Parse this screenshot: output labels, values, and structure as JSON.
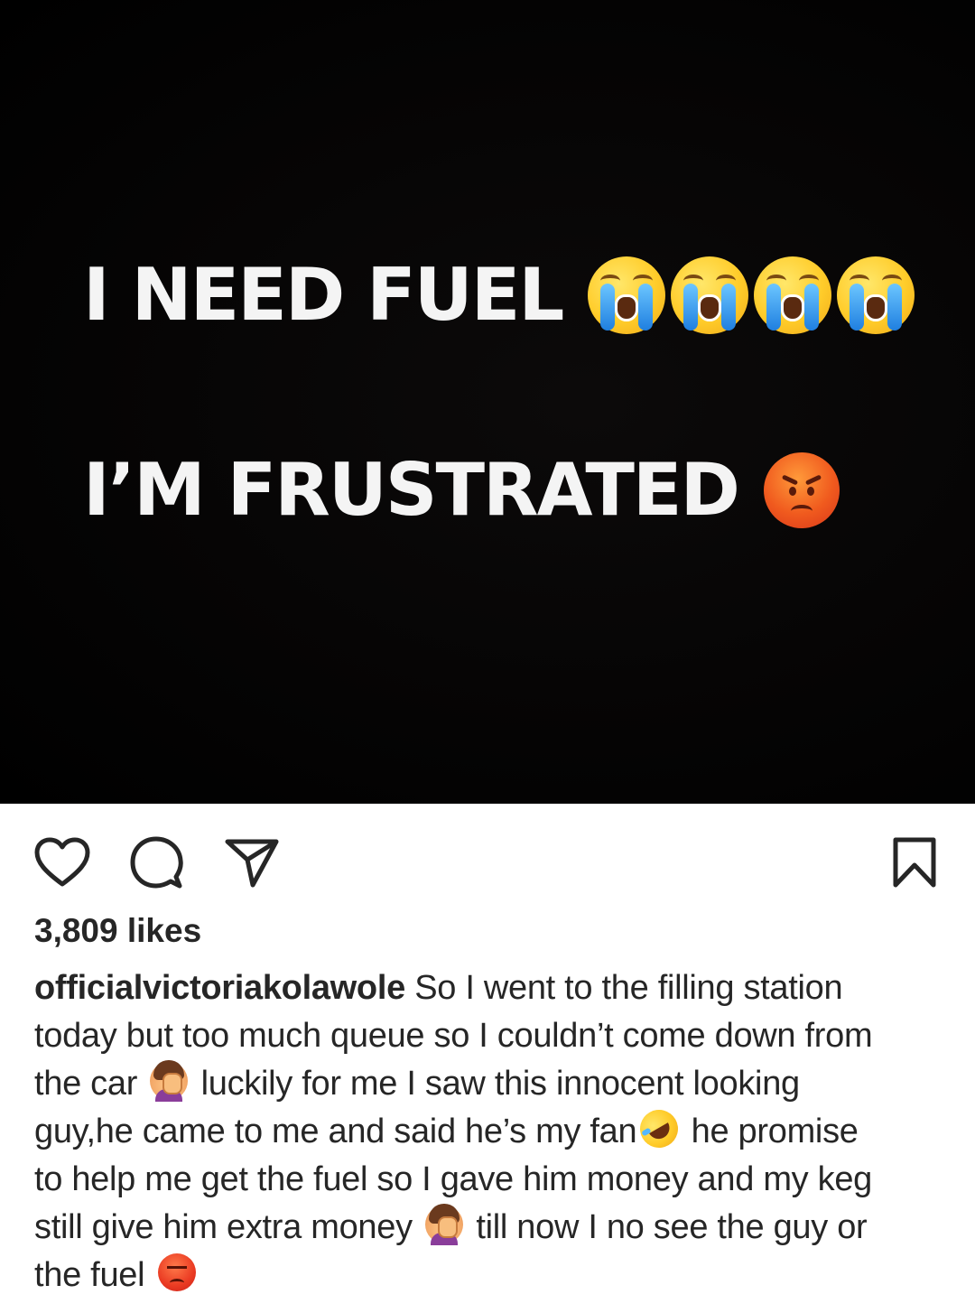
{
  "post_image": {
    "line1_text": "I NEED FUEL",
    "line2_text": "I’M FRUSTRATED",
    "line1_emojis": [
      "loudly-crying-face",
      "loudly-crying-face",
      "loudly-crying-face",
      "loudly-crying-face"
    ],
    "line2_emoji": "angry-face",
    "background_color": "#000000",
    "text_color": "#f4f4f4"
  },
  "actions": {
    "like_icon": "heart-icon",
    "comment_icon": "comment-bubble-icon",
    "share_icon": "paper-plane-icon",
    "save_icon": "bookmark-icon"
  },
  "likes": "3,809 likes",
  "caption": {
    "username": "officialvictoriakolawole",
    "line1_text": " So I went to the filling station",
    "line2_text": "today but too much queue so I couldn’t come down from",
    "line3_a": "the car",
    "line3_b": "luckily for me I saw this innocent looking",
    "line4_a": "guy,he came to me and said he’s my fan",
    "line4_b": "he promise",
    "line5_text": "to help me get the fuel so I gave him money and my keg",
    "line6_a": "still give him extra money",
    "line6_b": "till now I no see the guy or",
    "line7_a": "the fuel",
    "emojis": [
      "woman-facepalming",
      "rolling-on-the-floor-laughing",
      "woman-facepalming",
      "pouting-face"
    ]
  }
}
